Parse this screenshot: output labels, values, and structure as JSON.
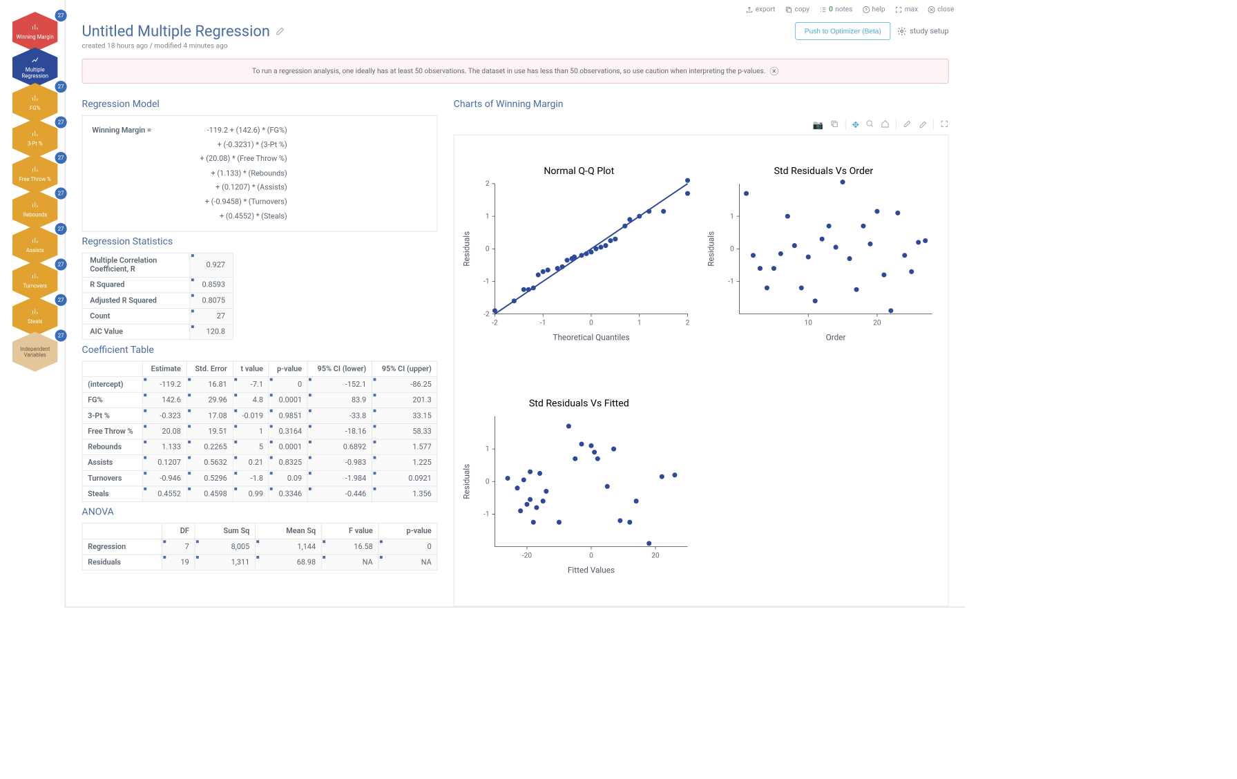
{
  "sidebar": {
    "items": [
      {
        "label": "Winning Margin",
        "badge": "27",
        "color": "red"
      },
      {
        "label": "Multiple Regression",
        "badge": "",
        "color": "blue"
      },
      {
        "label": "FG%",
        "badge": "27",
        "color": "amber"
      },
      {
        "label": "3-Pt %",
        "badge": "27",
        "color": "amber"
      },
      {
        "label": "Free Throw %",
        "badge": "27",
        "color": "amber"
      },
      {
        "label": "Rebounds",
        "badge": "27",
        "color": "amber"
      },
      {
        "label": "Assists",
        "badge": "27",
        "color": "amber"
      },
      {
        "label": "Turnovers",
        "badge": "27",
        "color": "amber"
      },
      {
        "label": "Steals",
        "badge": "27",
        "color": "amber"
      },
      {
        "label": "Independent Variables",
        "badge": "27",
        "color": "tan"
      }
    ]
  },
  "topbar": {
    "export": "export",
    "copy": "copy",
    "notes_count": "0",
    "notes": "notes",
    "help": "help",
    "max": "max",
    "close": "close"
  },
  "header": {
    "title": "Untitled Multiple Regression",
    "subtitle": "created 18 hours ago / modified 4 minutes ago",
    "push_btn": "Push to Optimizer (Beta)",
    "study_setup": "study setup"
  },
  "warning": "To run a regression analysis, one ideally has at least 50 observations. The dataset in use has less than 50 observations, so use caution when interpreting the p-values.",
  "sections": {
    "model": "Regression Model",
    "stats": "Regression Statistics",
    "coef": "Coefficient Table",
    "anova": "ANOVA",
    "charts": "Charts of Winning Margin"
  },
  "model": {
    "lhs": "Winning Margin =",
    "lines": [
      "-119.2 + (142.6) * (FG%)",
      "+ (-0.3231) * (3-Pt %)",
      "+ (20.08) * (Free Throw %)",
      "+ (1.133) * (Rebounds)",
      "+ (0.1207) * (Assists)",
      "+ (-0.9458) * (Turnovers)",
      "+ (0.4552) * (Steals)"
    ]
  },
  "stats": {
    "rows": [
      {
        "label": "Multiple Correlation Coefficient, R",
        "value": "0.927"
      },
      {
        "label": "R Squared",
        "value": "0.8593"
      },
      {
        "label": "Adjusted R Squared",
        "value": "0.8075"
      },
      {
        "label": "Count",
        "value": "27"
      },
      {
        "label": "AIC Value",
        "value": "120.8"
      }
    ]
  },
  "coef": {
    "headers": [
      "",
      "Estimate",
      "Std. Error",
      "t value",
      "p-value",
      "95% CI (lower)",
      "95% CI (upper)"
    ],
    "rows": [
      [
        "(intercept)",
        "-119.2",
        "16.81",
        "-7.1",
        "0",
        "-152.1",
        "-86.25"
      ],
      [
        "FG%",
        "142.6",
        "29.96",
        "4.8",
        "0.0001",
        "83.9",
        "201.3"
      ],
      [
        "3-Pt %",
        "-0.323",
        "17.08",
        "-0.019",
        "0.9851",
        "-33.8",
        "33.15"
      ],
      [
        "Free Throw %",
        "20.08",
        "19.51",
        "1",
        "0.3164",
        "-18.16",
        "58.33"
      ],
      [
        "Rebounds",
        "1.133",
        "0.2265",
        "5",
        "0.0001",
        "0.6892",
        "1.577"
      ],
      [
        "Assists",
        "0.1207",
        "0.5632",
        "0.21",
        "0.8325",
        "-0.983",
        "1.225"
      ],
      [
        "Turnovers",
        "-0.946",
        "0.5296",
        "-1.8",
        "0.09",
        "-1.984",
        "0.0921"
      ],
      [
        "Steals",
        "0.4552",
        "0.4598",
        "0.99",
        "0.3346",
        "-0.446",
        "1.356"
      ]
    ]
  },
  "anova": {
    "headers": [
      "",
      "DF",
      "Sum Sq",
      "Mean Sq",
      "F value",
      "p-value"
    ],
    "rows": [
      [
        "Regression",
        "7",
        "8,005",
        "1,144",
        "16.58",
        "0"
      ],
      [
        "Residuals",
        "19",
        "1,311",
        "68.98",
        "NA",
        "NA"
      ]
    ]
  },
  "chart_data": [
    {
      "type": "scatter",
      "title": "Normal Q-Q Plot",
      "xlabel": "Theoretical Quantiles",
      "ylabel": "Residuals",
      "xlim": [
        -2,
        2
      ],
      "ylim": [
        -2,
        2
      ],
      "xticks": [
        -2,
        -1,
        0,
        1,
        2
      ],
      "yticks": [
        -2,
        -1,
        0,
        1,
        2
      ],
      "line": {
        "x": [
          -2,
          2
        ],
        "y": [
          -2,
          2
        ]
      },
      "x": [
        -2.0,
        -1.6,
        -1.4,
        -1.3,
        -1.2,
        -1.1,
        -1.0,
        -0.9,
        -0.7,
        -0.6,
        -0.5,
        -0.4,
        -0.35,
        -0.2,
        -0.1,
        0.0,
        0.1,
        0.2,
        0.3,
        0.4,
        0.5,
        0.7,
        0.8,
        1.0,
        1.2,
        1.5,
        2.0
      ],
      "y": [
        -1.9,
        -1.6,
        -1.25,
        -1.25,
        -1.2,
        -0.8,
        -0.7,
        -0.65,
        -0.6,
        -0.55,
        -0.35,
        -0.3,
        -0.25,
        -0.2,
        -0.15,
        -0.1,
        0.0,
        0.05,
        0.1,
        0.25,
        0.3,
        0.7,
        0.9,
        1.0,
        1.15,
        1.15,
        1.7
      ],
      "last_point": {
        "x": 2.0,
        "y": 2.1
      }
    },
    {
      "type": "scatter",
      "title": "Std Residuals Vs Order",
      "xlabel": "Order",
      "ylabel": "Residuals",
      "xlim": [
        0,
        28
      ],
      "ylim": [
        -2,
        2
      ],
      "xticks": [
        10,
        20
      ],
      "yticks": [
        -1,
        0,
        1
      ],
      "x": [
        1,
        2,
        3,
        4,
        5,
        6,
        7,
        8,
        9,
        10,
        11,
        12,
        13,
        14,
        15,
        16,
        17,
        18,
        19,
        20,
        21,
        22,
        23,
        24,
        25,
        26,
        27
      ],
      "y": [
        1.7,
        -0.2,
        -0.6,
        -1.2,
        -0.6,
        -0.15,
        1.0,
        0.1,
        -1.2,
        -0.25,
        -1.6,
        0.3,
        0.7,
        0.05,
        2.05,
        -0.3,
        -1.25,
        0.7,
        0.15,
        1.15,
        -0.8,
        -1.9,
        1.1,
        -0.2,
        -0.7,
        0.2,
        0.25
      ]
    },
    {
      "type": "scatter",
      "title": "Std Residuals Vs Fitted",
      "xlabel": "Fitted Values",
      "ylabel": "Residuals",
      "xlim": [
        -30,
        30
      ],
      "ylim": [
        -2,
        2
      ],
      "xticks": [
        -20,
        0,
        20
      ],
      "yticks": [
        -1,
        0,
        1
      ],
      "x": [
        -26,
        -23,
        -22,
        -21,
        -20,
        -19,
        -19,
        -18,
        -17,
        -16,
        -15,
        -14,
        -10,
        -7,
        -5,
        -3,
        0,
        1,
        2,
        5,
        7,
        9,
        12,
        14,
        18,
        22,
        26
      ],
      "y": [
        0.1,
        -0.2,
        -0.9,
        0.05,
        -0.7,
        -0.55,
        0.3,
        -1.25,
        -0.8,
        0.25,
        -0.6,
        -0.3,
        -1.25,
        1.7,
        0.7,
        1.15,
        1.1,
        0.9,
        0.7,
        -0.15,
        1.0,
        -1.2,
        -1.25,
        -0.6,
        -1.9,
        0.15,
        0.2
      ]
    }
  ]
}
